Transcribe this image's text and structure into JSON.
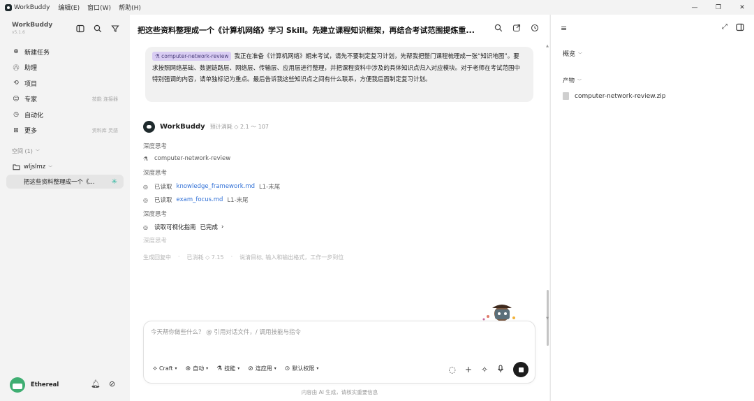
{
  "titlebar": {
    "app_name": "WorkBuddy",
    "menus": [
      "编辑(E)",
      "窗口(W)",
      "帮助(H)"
    ]
  },
  "sidebar": {
    "brand": "WorkBuddy",
    "version": "v5.1.6",
    "nav": [
      {
        "label": "新建任务",
        "icon": "plus-circle-icon",
        "hint": ""
      },
      {
        "label": "助理",
        "icon": "assistant-icon",
        "hint": ""
      },
      {
        "label": "项目",
        "icon": "project-icon",
        "hint": ""
      },
      {
        "label": "专家",
        "icon": "expert-icon",
        "hint": "技能 连接器"
      },
      {
        "label": "自动化",
        "icon": "clock-icon",
        "hint": ""
      },
      {
        "label": "更多",
        "icon": "grid-icon",
        "hint": "资料库 灵感"
      }
    ],
    "space_label": "空间 (1)",
    "folder": "wljslmz",
    "thread": "把这些资料整理成一个《..."
  },
  "user": {
    "name": "Ethereal"
  },
  "main": {
    "title": "把这些资料整理成一个《计算机网络》学习 Skill。先建立课程知识框架，再结合考试范围提炼重...",
    "message": {
      "chip": "computer-network-review",
      "text": "我正在准备《计算机网络》期末考试，请先不要制定复习计划，先帮我把整门课程梳理成一张“知识地图”。要求按照网络基础、数据链路层、网络层、传输层、应用层进行整理，并把课程资料中涉及的具体知识点归入对应模块。对于老师在考试范围中特别强调的内容，请单独标记为重点。最后告诉我这些知识点之间有什么联系，方便我后面制定复习计划。"
    },
    "agent": {
      "name": "WorkBuddy",
      "cost": "预计消耗 ◇ 2.1 ～ 107"
    },
    "think1": "深度思考",
    "skill_step": "computer-network-review",
    "think2": "深度思考",
    "read1": {
      "verb": "已读取",
      "file": "knowledge_framework.md",
      "range": "L1-末尾"
    },
    "read2": {
      "verb": "已读取",
      "file": "exam_focus.md",
      "range": "L1-末尾"
    },
    "think3": "深度思考",
    "guide": {
      "label": "读取可视化指南",
      "status": "已完成"
    },
    "think4": "深度思考",
    "status": {
      "generating": "生成回复中",
      "consumed": "已消耗 ◇ 7.15",
      "tip": "说清目标, 输入和输出格式，工作一步到位"
    },
    "input": {
      "placeholder": "今天帮你做些什么？ @ 引用对话文件，/ 调用技能与指令",
      "tools": [
        "Craft",
        "自动",
        "技能",
        "连应用",
        "默认权限"
      ]
    },
    "disclaimer": "内容由 AI 生成，请核实重要信息"
  },
  "right_panel": {
    "overview": "概览",
    "products": "产物",
    "file": "computer-network-review.zip"
  }
}
